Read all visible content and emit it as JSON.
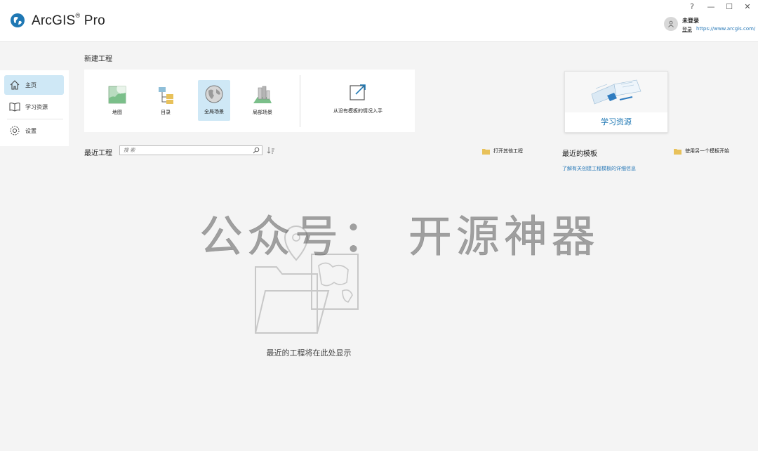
{
  "app": {
    "title": "ArcGIS",
    "title_suffix": "Pro",
    "reg_mark": "®"
  },
  "window_controls": {
    "help": "?",
    "minimize": "—",
    "maximize": "☐",
    "close": "✕"
  },
  "user": {
    "status": "未登录",
    "signin_label": "登录",
    "portal_url": "https://www.arcgis.com/"
  },
  "sidebar": {
    "items": [
      {
        "label": "主页",
        "icon": "home-icon",
        "active": true
      },
      {
        "label": "学习资源",
        "icon": "book-icon",
        "active": false
      },
      {
        "label": "设置",
        "icon": "gear-icon",
        "active": false
      }
    ]
  },
  "new_project": {
    "title": "新建工程",
    "templates": [
      {
        "label": "地图",
        "icon": "map-icon"
      },
      {
        "label": "目录",
        "icon": "catalog-icon"
      },
      {
        "label": "全局场景",
        "icon": "global-scene-icon",
        "selected": true
      },
      {
        "label": "局部场景",
        "icon": "local-scene-icon"
      }
    ],
    "blank": {
      "label": "从没有模板的情况入手",
      "icon": "external-arrow-icon"
    }
  },
  "learning": {
    "label": "学习资源"
  },
  "recent_projects": {
    "title": "最近工程",
    "search_placeholder": "搜 索",
    "open_other_label": "打开其他工程",
    "empty_text": "最近的工程将在此处显示"
  },
  "recent_templates": {
    "title": "最近的模板",
    "use_other_label": "使用另一个模板开始",
    "details_link": "了解有关创建工程模板的详细信息"
  },
  "watermark": {
    "text": "公众号：  开源神器"
  },
  "colors": {
    "accent": "#1f78b4",
    "selected_bg": "#cfe8f6",
    "folder": "#e8c15a",
    "link": "#2a7ab8"
  }
}
